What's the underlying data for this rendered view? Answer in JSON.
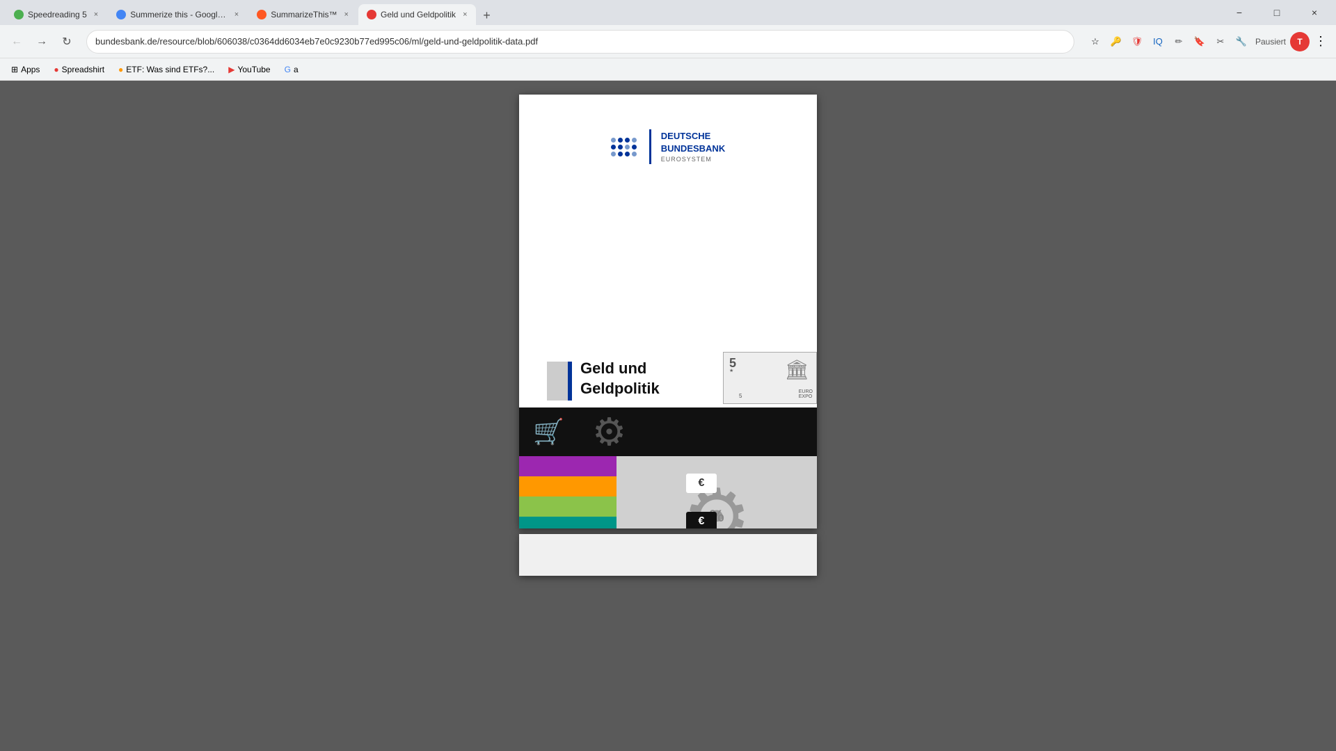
{
  "browser": {
    "tabs": [
      {
        "id": "tab1",
        "label": "Speedreading 5",
        "favicon_color": "#4CAF50",
        "active": false
      },
      {
        "id": "tab2",
        "label": "Summerize this - Google-Suche",
        "favicon_color": "#4285F4",
        "active": false
      },
      {
        "id": "tab3",
        "label": "SummarizeThis™",
        "favicon_color": "#FF5722",
        "active": false
      },
      {
        "id": "tab4",
        "label": "Geld und Geldpolitik",
        "favicon_color": "#E53935",
        "active": true
      }
    ],
    "new_tab_label": "+",
    "title_bar_buttons": [
      "−",
      "□",
      "×"
    ],
    "address": "bundesbank.de/resource/blob/606038/c0364dd6034eb7e0c9230b77ed995c06/ml/geld-und-geldpolitik-data.pdf",
    "nav_buttons": {
      "back": "←",
      "forward": "→",
      "refresh": "↻"
    }
  },
  "bookmarks": [
    {
      "label": "Apps",
      "icon": "⊞"
    },
    {
      "label": "Spreadshirt",
      "icon": "S"
    },
    {
      "label": "ETF: Was sind ETFs?...",
      "icon": "E"
    },
    {
      "label": "YouTube",
      "icon": "▶"
    },
    {
      "label": "a",
      "icon": "G"
    }
  ],
  "extensions": {
    "pausiert_label": "Pausiert"
  },
  "pdf": {
    "logo": {
      "main_text": "DEUTSCHE",
      "sub_text1": "BUNDESBANK",
      "sub_text2": "EUROSYSTEM"
    },
    "title_line1": "Geld und",
    "title_line2": "Geldpolitik",
    "color_bars": [
      "#9C27B0",
      "#FF9800",
      "#8BC34A",
      "#009688",
      "#FF5722",
      "#4CAF50"
    ],
    "gear_symbol": "⚙",
    "percent_symbol": "%",
    "cart_symbol": "🛒",
    "euro_symbol": "€"
  }
}
